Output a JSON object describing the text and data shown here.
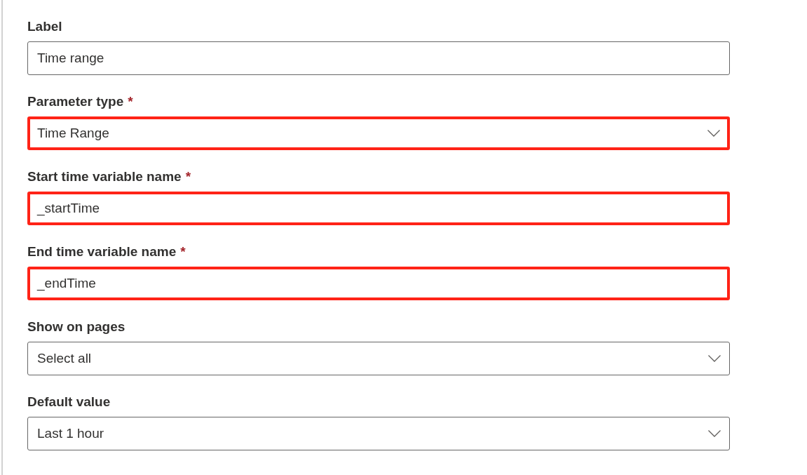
{
  "fields": [
    {
      "label": "Label",
      "kind": "text",
      "value": "Time range",
      "highlighted": false
    },
    {
      "label": "Parameter type",
      "required_mark": "*",
      "kind": "dropdown",
      "value": "Time Range",
      "highlighted": true
    },
    {
      "label": "Start time variable name",
      "required_mark": "*",
      "kind": "text",
      "value": "_startTime",
      "highlighted": true
    },
    {
      "label": "End time variable name",
      "required_mark": "*",
      "kind": "text",
      "value": "_endTime",
      "highlighted": true
    },
    {
      "label": "Show on pages",
      "kind": "dropdown",
      "value": "Select all",
      "highlighted": false
    },
    {
      "label": "Default value",
      "kind": "dropdown",
      "value": "Last 1 hour",
      "highlighted": false
    }
  ]
}
